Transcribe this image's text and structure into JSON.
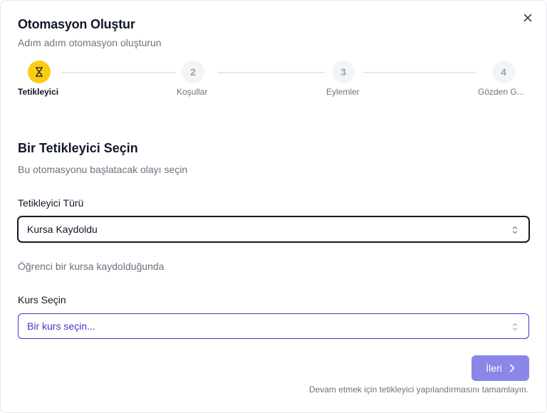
{
  "dialog": {
    "title": "Otomasyon Oluştur",
    "subtitle": "Adım adım otomasyon oluşturun",
    "close_icon": "close-icon"
  },
  "stepper": {
    "steps": [
      {
        "number": "1",
        "label": "Tetikleyici",
        "active": true,
        "icon": "hourglass-icon"
      },
      {
        "number": "2",
        "label": "Koşullar",
        "active": false
      },
      {
        "number": "3",
        "label": "Eylemler",
        "active": false
      },
      {
        "number": "4",
        "label": "Gözden G...",
        "active": false
      }
    ]
  },
  "section": {
    "title": "Bir Tetikleyici Seçin",
    "description": "Bu otomasyonu başlatacak olayı seçin"
  },
  "trigger_type": {
    "label": "Tetikleyici Türü",
    "value": "Kursa Kaydoldu",
    "hint": "Öğrenci bir kursa kaydolduğunda"
  },
  "course": {
    "label": "Kurs Seçin",
    "placeholder": "Bir kurs seçin..."
  },
  "footer": {
    "next_label": "İleri",
    "note": "Devam etmek için tetikleyici yapılandırmasını tamamlayın."
  },
  "colors": {
    "accent": "#facc15",
    "primary_disabled": "#8b86e8",
    "placeholder_border": "#4338ca"
  }
}
